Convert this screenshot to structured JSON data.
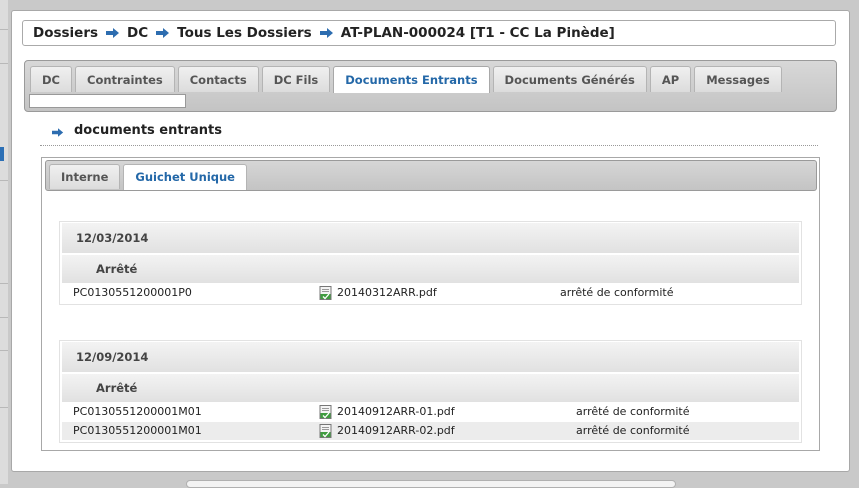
{
  "breadcrumb": {
    "items": [
      "Dossiers",
      "DC",
      "Tous Les Dossiers",
      "AT-PLAN-000024 [T1 - CC La Pinède]"
    ]
  },
  "tabs": [
    {
      "label": "DC",
      "active": false
    },
    {
      "label": "Contraintes",
      "active": false
    },
    {
      "label": "Contacts",
      "active": false
    },
    {
      "label": "DC Fils",
      "active": false
    },
    {
      "label": "Documents Entrants",
      "active": true
    },
    {
      "label": "Documents Générés",
      "active": false
    },
    {
      "label": "AP",
      "active": false
    },
    {
      "label": "Messages",
      "active": false
    }
  ],
  "tab_search": {
    "value": ""
  },
  "section": {
    "title": "documents entrants"
  },
  "subtabs": [
    {
      "label": "Interne",
      "active": false
    },
    {
      "label": "Guichet Unique",
      "active": true
    }
  ],
  "groups": [
    {
      "date": "12/03/2014",
      "type": "Arrêté",
      "rows": [
        {
          "ref": "PC0130551200001P0",
          "file": "20140312ARR.pdf",
          "desc": "arrêté de conformité"
        }
      ]
    },
    {
      "date": "12/09/2014",
      "type": "Arrêté",
      "rows": [
        {
          "ref": "PC0130551200001M01",
          "file": "20140912ARR-01.pdf",
          "desc": "arrêté de conformité"
        },
        {
          "ref": "PC0130551200001M01",
          "file": "20140912ARR-02.pdf",
          "desc": "arrêté de conformité"
        }
      ]
    }
  ],
  "icons": {
    "breadcrumb_separator": "arrow-right-icon",
    "section_marker": "arrow-right-icon",
    "file": "pdf-file-icon"
  },
  "colors": {
    "accent": "#2468a8",
    "arrow": "#2d6db0"
  }
}
